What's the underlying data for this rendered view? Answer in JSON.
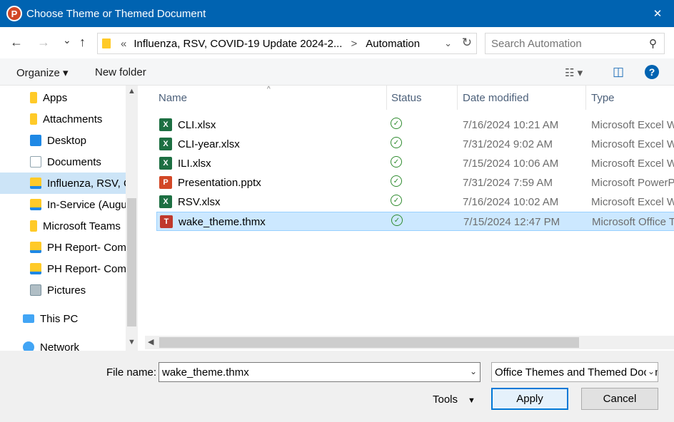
{
  "window": {
    "title": "Choose Theme or Themed Document",
    "app_icon_letter": "P",
    "close_glyph": "✕"
  },
  "nav": {
    "back_glyph": "←",
    "forward_glyph": "→",
    "dropdown_glyph": "⌄",
    "up_glyph": "↑",
    "breadcrumb_overflow": "«",
    "breadcrumb_parent": "Influenza, RSV, COVID-19 Update 2024-2...",
    "breadcrumb_sep": ">",
    "breadcrumb_current": "Automation",
    "address_dropdown_glyph": "⌄",
    "refresh_glyph": "↻",
    "search_placeholder": "Search Automation",
    "search_glyph": "⚲"
  },
  "toolbar": {
    "organize_label": "Organize ▾",
    "new_folder_label": "New folder",
    "view_glyph": "☷ ▾",
    "preview_glyph": "◫",
    "help_glyph": "?"
  },
  "sidebar": {
    "items": [
      {
        "label": "Apps",
        "icon": "folder-icon",
        "color": "#ffca28"
      },
      {
        "label": "Attachments",
        "icon": "folder-icon",
        "color": "#ffca28"
      },
      {
        "label": "Desktop",
        "icon": "desktop-icon",
        "color": "#1e88e5"
      },
      {
        "label": "Documents",
        "icon": "documents-icon",
        "color": "#90a4ae"
      },
      {
        "label": "Influenza, RSV, C",
        "icon": "shared-folder-icon",
        "color": "#ffca28"
      },
      {
        "label": "In-Service (Augu",
        "icon": "shared-folder-icon",
        "color": "#ffca28"
      },
      {
        "label": "Microsoft Teams",
        "icon": "folder-icon",
        "color": "#ffca28"
      },
      {
        "label": "PH Report- Com",
        "icon": "shared-folder-icon",
        "color": "#ffca28"
      },
      {
        "label": "PH Report- Com",
        "icon": "shared-folder-icon",
        "color": "#ffca28"
      },
      {
        "label": "Pictures",
        "icon": "pictures-icon",
        "color": "#78909c"
      },
      {
        "label": "This PC",
        "icon": "this-pc-icon",
        "color": "#42a5f5"
      },
      {
        "label": "Network",
        "icon": "network-icon",
        "color": "#42a5f5"
      }
    ],
    "selected_index": 4,
    "scroll_up_glyph": "▲",
    "scroll_down_glyph": "▼"
  },
  "columns": {
    "name": "Name",
    "status": "Status",
    "date": "Date modified",
    "type": "Type",
    "sort_glyph": "^"
  },
  "files": [
    {
      "name": "CLI.xlsx",
      "icon": "excel-icon",
      "icon_letter": "X",
      "color": "#1d6f42",
      "status": "✓",
      "date": "7/16/2024 10:21 AM",
      "type": "Microsoft Excel W"
    },
    {
      "name": "CLI-year.xlsx",
      "icon": "excel-icon",
      "icon_letter": "X",
      "color": "#1d6f42",
      "status": "✓",
      "date": "7/31/2024 9:02 AM",
      "type": "Microsoft Excel W"
    },
    {
      "name": "ILI.xlsx",
      "icon": "excel-icon",
      "icon_letter": "X",
      "color": "#1d6f42",
      "status": "✓",
      "date": "7/15/2024 10:06 AM",
      "type": "Microsoft Excel W"
    },
    {
      "name": "Presentation.pptx",
      "icon": "powerpoint-icon",
      "icon_letter": "P",
      "color": "#d24726",
      "status": "✓",
      "date": "7/31/2024 7:59 AM",
      "type": "Microsoft PowerP"
    },
    {
      "name": "RSV.xlsx",
      "icon": "excel-icon",
      "icon_letter": "X",
      "color": "#1d6f42",
      "status": "✓",
      "date": "7/16/2024 10:02 AM",
      "type": "Microsoft Excel W"
    },
    {
      "name": "wake_theme.thmx",
      "icon": "theme-icon",
      "icon_letter": "T",
      "color": "#c0392b",
      "status": "✓",
      "date": "7/15/2024 12:47 PM",
      "type": "Microsoft Office T"
    }
  ],
  "selected_file_index": 5,
  "hscroll_left_glyph": "◀",
  "bottom": {
    "file_name_label": "File name:",
    "file_name_value": "wake_theme.thmx",
    "file_name_dropdown_glyph": "⌄",
    "filter_value": "Office Themes and Themed Documents",
    "filter_dropdown_glyph": "⌄",
    "tools_label": "Tools",
    "tools_caret": "▼",
    "apply_label": "Apply",
    "cancel_label": "Cancel"
  },
  "colors": {
    "titlebar": "#0063b1",
    "selection": "#cce8ff",
    "nav_selection": "#cce4f7",
    "status_green": "#2e8b2e"
  }
}
